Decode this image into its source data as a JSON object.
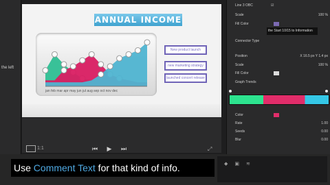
{
  "left": {
    "text": "the left"
  },
  "chart": {
    "title": "ANNUAL INCOME",
    "legend": [
      "New product launch",
      "new marketing strategy",
      "launched concert release"
    ],
    "months": [
      "jan",
      "feb",
      "mar",
      "apr",
      "may",
      "jun",
      "jul",
      "aug",
      "sep",
      "oct",
      "nov",
      "dec"
    ],
    "series": [
      {
        "color": "#2fbf93",
        "values": [
          8,
          16,
          11,
          7,
          4,
          3,
          2,
          2,
          2,
          2,
          2,
          2
        ]
      },
      {
        "color": "#d91e62",
        "values": [
          3,
          3,
          8,
          10,
          13,
          16,
          11,
          6,
          4,
          3,
          2,
          2
        ]
      },
      {
        "color": "#4fb4d1",
        "values": [
          2,
          2,
          2,
          2,
          2,
          3,
          6,
          10,
          14,
          16,
          18,
          22
        ]
      }
    ],
    "ylim": [
      0,
      24
    ]
  },
  "viewer_controls": {
    "play": "▶",
    "prev": "⏮",
    "next": "⏭",
    "left_small": "1:1",
    "right_small": "⤢"
  },
  "inspector": {
    "rows": [
      {
        "label": "Line 3 OBC",
        "value": "",
        "check": true
      },
      {
        "label": "Scale",
        "value": "100 %"
      },
      {
        "label": "Fill Color",
        "value": "",
        "swatch": "#7c6ab3"
      },
      {
        "label": "Connector Type",
        "value": ""
      },
      {
        "label": "Position",
        "value": "X 16.5 px  Y 1.4 px"
      },
      {
        "label": "Scale",
        "value": "100 %"
      },
      {
        "label": "Fill Color",
        "value": "",
        "swatch": "#dcdcdc"
      },
      {
        "label": "Graph Trends",
        "value": ""
      },
      {
        "label": "Color",
        "value": "",
        "swatch": "#e12d6a"
      },
      {
        "label": "Rate",
        "value": "1.00"
      },
      {
        "label": "Seeds",
        "value": "0.00"
      },
      {
        "label": "Blur",
        "value": "0.00"
      }
    ],
    "tooltip": "the Start 10/15 to Information"
  },
  "caption": {
    "pre": "Use ",
    "accent": "Comment Text",
    "post": " for that kind of info."
  }
}
